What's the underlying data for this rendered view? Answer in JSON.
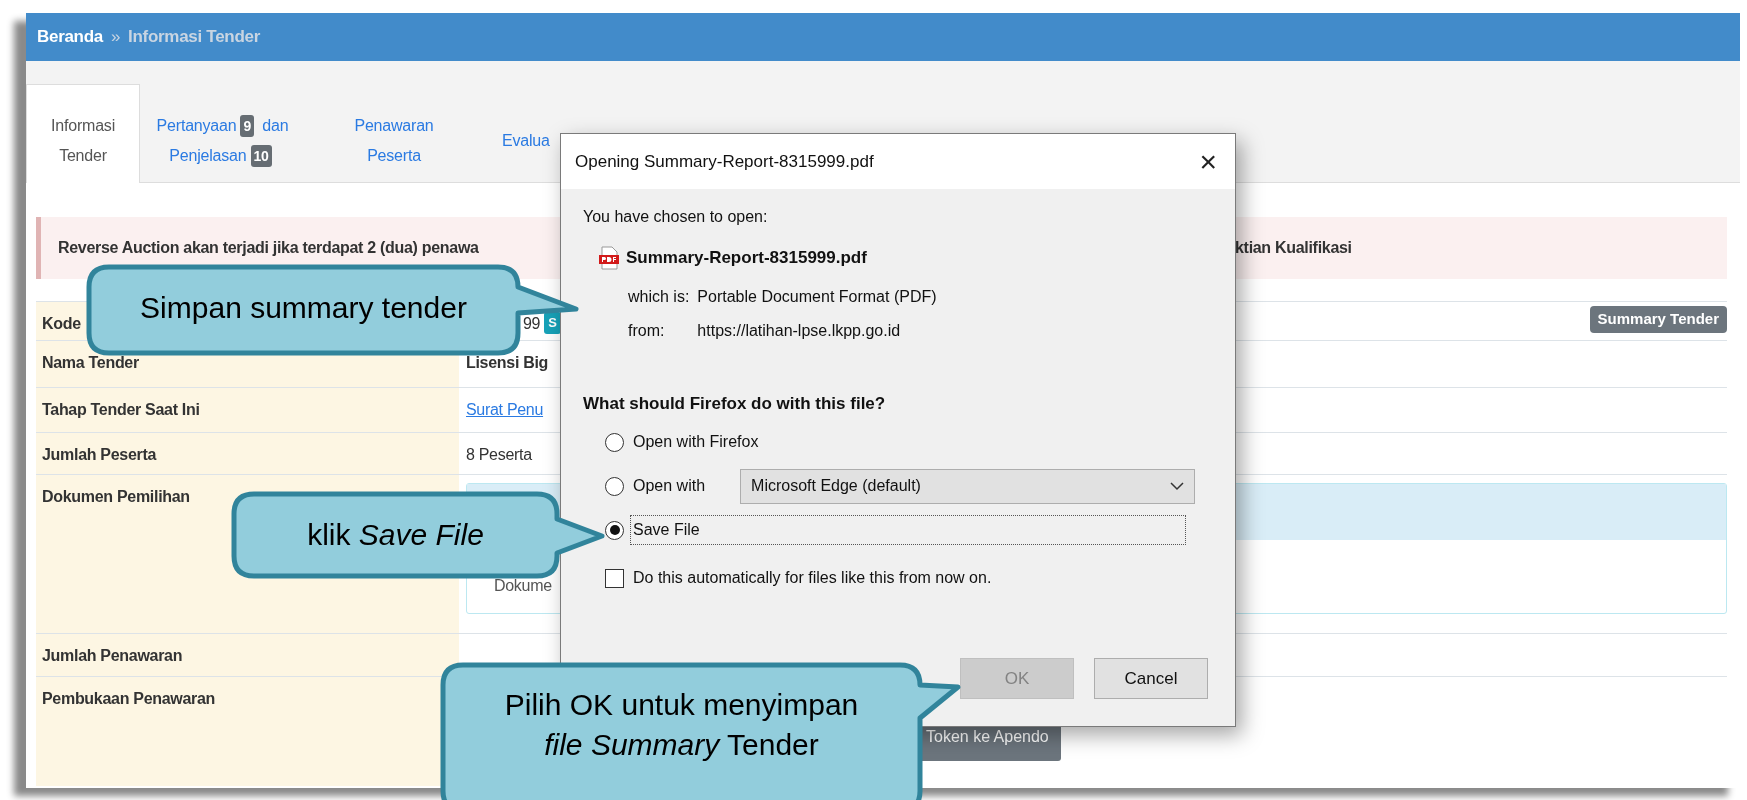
{
  "breadcrumb": [
    {
      "label": "Beranda",
      "current": false
    },
    {
      "label": "Informasi Tender",
      "current": true
    }
  ],
  "breadcrumb_separator": "»",
  "tabs": [
    {
      "selected": true,
      "lines": [
        [
          {
            "text": "Informasi"
          }
        ],
        [
          {
            "text": "Tender"
          }
        ]
      ]
    },
    {
      "selected": false,
      "lines": [
        [
          {
            "text": "Pertanyaan"
          },
          {
            "badge": "9"
          },
          {
            "text": "dan"
          }
        ],
        [
          {
            "text": "Penjelasan"
          },
          {
            "badge": "10"
          }
        ]
      ]
    },
    {
      "selected": false,
      "lines": [
        [
          {
            "text": "Penawaran"
          }
        ],
        [
          {
            "text": "Peserta"
          }
        ]
      ]
    },
    {
      "selected": false,
      "lines": [
        [
          {
            "text": "Evalua"
          }
        ]
      ]
    }
  ],
  "alert": {
    "left": "Reverse Auction akan terjadi jika terdapat 2 (dua) penawa",
    "right": "ktian Kualifikasi"
  },
  "rows": [
    {
      "label": "Kode",
      "kind": "code",
      "value": "99",
      "badge": "S",
      "action": "Summary Tender"
    },
    {
      "label": "Nama Tender",
      "kind": "strong",
      "value": "Lisensi Big"
    },
    {
      "label": "Tahap Tender Saat Ini",
      "kind": "link",
      "value": "Surat Penu"
    },
    {
      "label": "Jumlah Peserta",
      "kind": "text",
      "value": "8 Peserta"
    },
    {
      "label": "Dokumen Pemilihan",
      "kind": "panel",
      "value": "Dokume"
    },
    {
      "label": "Jumlah Penawaran",
      "kind": "text"
    },
    {
      "label": "Pembukaan Penawaran",
      "kind": "button",
      "value": "Token ke Apendo"
    }
  ],
  "dialog": {
    "title": "Opening Summary-Report-8315999.pdf",
    "close": "×",
    "intro": "You have chosen to open:",
    "file_name": "Summary-Report-8315999.pdf",
    "details": [
      {
        "label": "which is:",
        "value": "Portable Document Format (PDF)"
      },
      {
        "label": "from:",
        "value": "https://latihan-lpse.lkpp.go.id"
      }
    ],
    "question": "What should Firefox do with this file?",
    "options": [
      {
        "kind": "radio",
        "label": "Open with Firefox",
        "selected": false
      },
      {
        "kind": "radio-select",
        "label": "Open with",
        "selected": false,
        "select_value": "Microsoft Edge (default)"
      },
      {
        "kind": "radio",
        "label": "Save File",
        "selected": true,
        "focused": true
      }
    ],
    "remember": {
      "label": "Do this automatically for files like this from now on.",
      "checked": false
    },
    "buttons": [
      {
        "label": "OK",
        "disabled": true
      },
      {
        "label": "Cancel",
        "disabled": false
      }
    ]
  },
  "callouts": [
    {
      "text": "Simpan summary tender"
    },
    {
      "text": "klik *Save File*"
    },
    {
      "text": "Pilih OK untuk menyimpan *file Summary* Tender"
    }
  ]
}
